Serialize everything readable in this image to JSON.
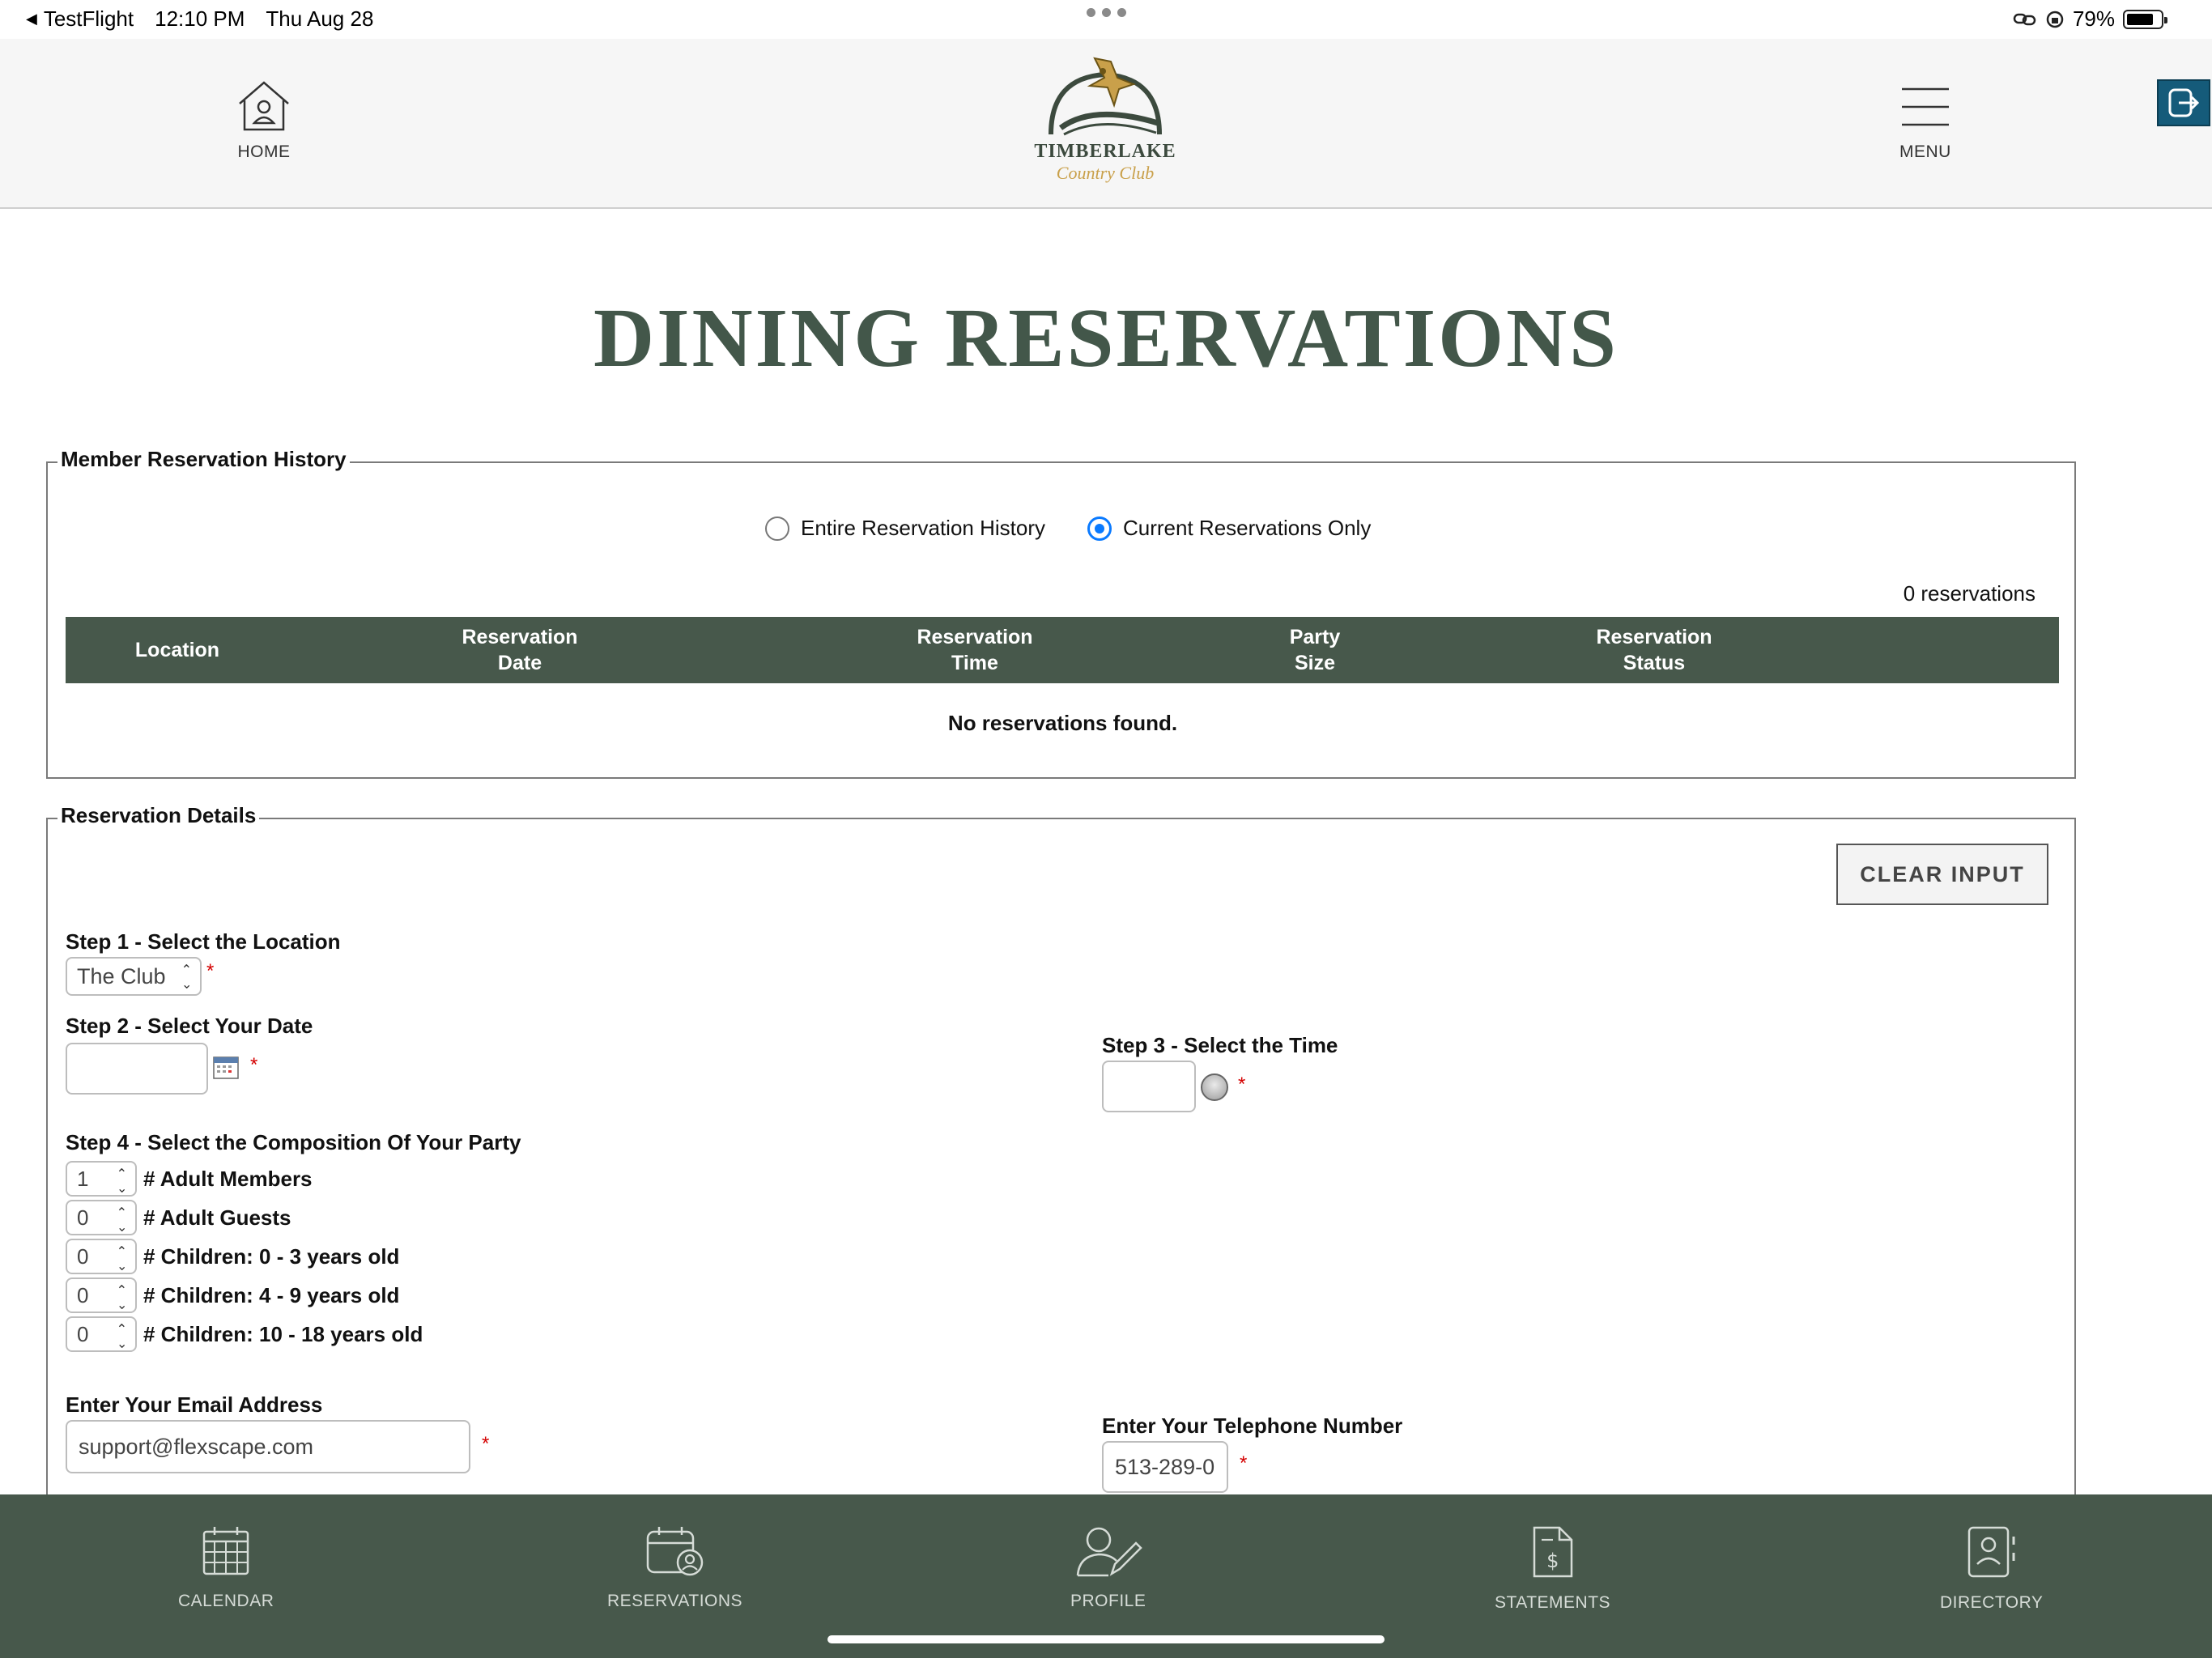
{
  "status_bar": {
    "back_app": "TestFlight",
    "time": "12:10 PM",
    "date": "Thu Aug 28",
    "battery": "79%"
  },
  "header": {
    "home_label": "HOME",
    "menu_label": "MENU",
    "logo_name": "TIMBERLAKE",
    "logo_sub": "Country Club"
  },
  "page_title": "DINING RESERVATIONS",
  "history": {
    "legend": "Member Reservation History",
    "radio_all": "Entire Reservation History",
    "radio_current": "Current Reservations Only",
    "selected": "current",
    "count": "0 reservations",
    "columns": {
      "location": "Location",
      "date_1": "Reservation",
      "date_2": "Date",
      "time_1": "Reservation",
      "time_2": "Time",
      "party_1": "Party",
      "party_2": "Size",
      "status_1": "Reservation",
      "status_2": "Status"
    },
    "empty_message": "No reservations found."
  },
  "details": {
    "legend": "Reservation Details",
    "clear_button": "CLEAR INPUT",
    "step1_label": "Step 1 - Select the Location",
    "location_value": "The Club",
    "step2_label": "Step 2 - Select Your Date",
    "date_value": "",
    "step3_label": "Step 3 - Select the Time",
    "time_value": "",
    "step4_label": "Step 4 - Select the Composition Of Your Party",
    "party": [
      {
        "value": "1",
        "label": "# Adult Members"
      },
      {
        "value": "0",
        "label": "# Adult Guests"
      },
      {
        "value": "0",
        "label": "# Children: 0 - 3 years old"
      },
      {
        "value": "0",
        "label": "# Children: 4 - 9 years old"
      },
      {
        "value": "0",
        "label": "# Children: 10 - 18 years old"
      }
    ],
    "email_label": "Enter Your Email Address",
    "email_value": "support@flexscape.com",
    "phone_label": "Enter Your Telephone Number",
    "phone_value": "513-289-0",
    "required_mark": "*"
  },
  "tab_bar": {
    "calendar": "CALENDAR",
    "reservations": "RESERVATIONS",
    "profile": "PROFILE",
    "statements": "STATEMENTS",
    "directory": "DIRECTORY"
  },
  "colors": {
    "brand_green": "#47584b",
    "title_green": "#43574a",
    "logo_gold": "#c9a04a",
    "radio_blue": "#0a7aff",
    "required_red": "#d40000",
    "exit_blue": "#155b7a"
  }
}
